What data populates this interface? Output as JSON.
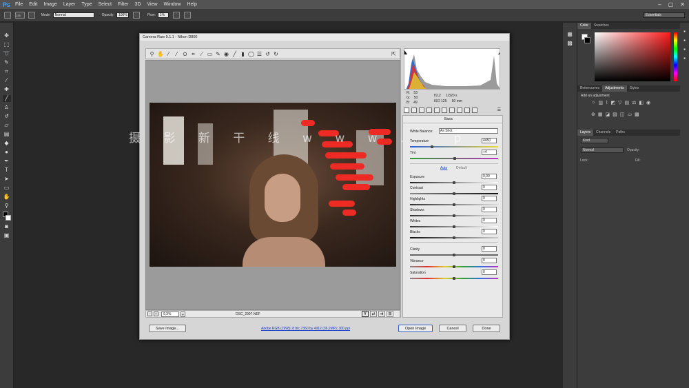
{
  "app": {
    "logo": "Ps"
  },
  "menu": [
    "File",
    "Edit",
    "Image",
    "Layer",
    "Type",
    "Select",
    "Filter",
    "3D",
    "View",
    "Window",
    "Help"
  ],
  "window_controls": [
    "–",
    "▢",
    "✕"
  ],
  "options": {
    "brush_size": "125",
    "mode_label": "Mode:",
    "mode_value": "Normal",
    "opacity_label": "Opacity:",
    "opacity_value": "100%",
    "flow_label": "Flow:",
    "flow_value": "1%",
    "workspace": "Essentials"
  },
  "panels": {
    "color_tabs": [
      "Color",
      "Swatches"
    ],
    "adjust_tabs": [
      "Bettercurves",
      "Adjustments",
      "Styles"
    ],
    "adjust_title": "Add an adjustment",
    "layer_tabs": [
      "Layers",
      "Channels",
      "Paths"
    ],
    "kind": "Kind",
    "blend": "Normal",
    "opacity_label": "Opacity:",
    "lock_label": "Lock:",
    "fill_label": "Fill:"
  },
  "dialog": {
    "title": "Camera Raw 9.1.1  -  Nikon D800",
    "zoom": "9,3%",
    "filename": "DSC_2997.NEF",
    "save_button": "Save Image...",
    "info_link": "Adobe RGB (1998); 8 bit; 7360 by 4912 (36,2MP); 300 ppi",
    "open_button": "Open Image",
    "cancel_button": "Cancel",
    "done_button": "Done",
    "rgb": {
      "r_label": "R:",
      "r": "53",
      "g_label": "G:",
      "g": "50",
      "b_label": "B:",
      "b": "49"
    },
    "camera": {
      "aperture": "f/2,2",
      "shutter": "1/320 s",
      "iso": "ISO 125",
      "focal": "50 mm"
    },
    "basic": {
      "header": "Basic",
      "wb_label": "White Balance:",
      "wb_value": "As Shot",
      "temperature_label": "Temperature",
      "temperature": "4450",
      "tint_label": "Tint",
      "tint": "+4",
      "auto": "Auto",
      "default": "Default",
      "exposure_label": "Exposure",
      "exposure": "0,00",
      "contrast_label": "Contrast",
      "contrast": "0",
      "highlights_label": "Highlights",
      "highlights": "0",
      "shadows_label": "Shadows",
      "shadows": "0",
      "whites_label": "Whites",
      "whites": "0",
      "blacks_label": "Blacks",
      "blacks": "0",
      "clarity_label": "Clarity",
      "clarity": "0",
      "vibrance_label": "Vibrance",
      "vibrance": "0",
      "saturation_label": "Saturation",
      "saturation": "0"
    }
  },
  "watermark": "摄 影 新 干 线   w w w .     .  p",
  "colors": {
    "accent": "#4aa3ff",
    "clipping": "#ee2a24",
    "link": "#1a3cc8"
  }
}
